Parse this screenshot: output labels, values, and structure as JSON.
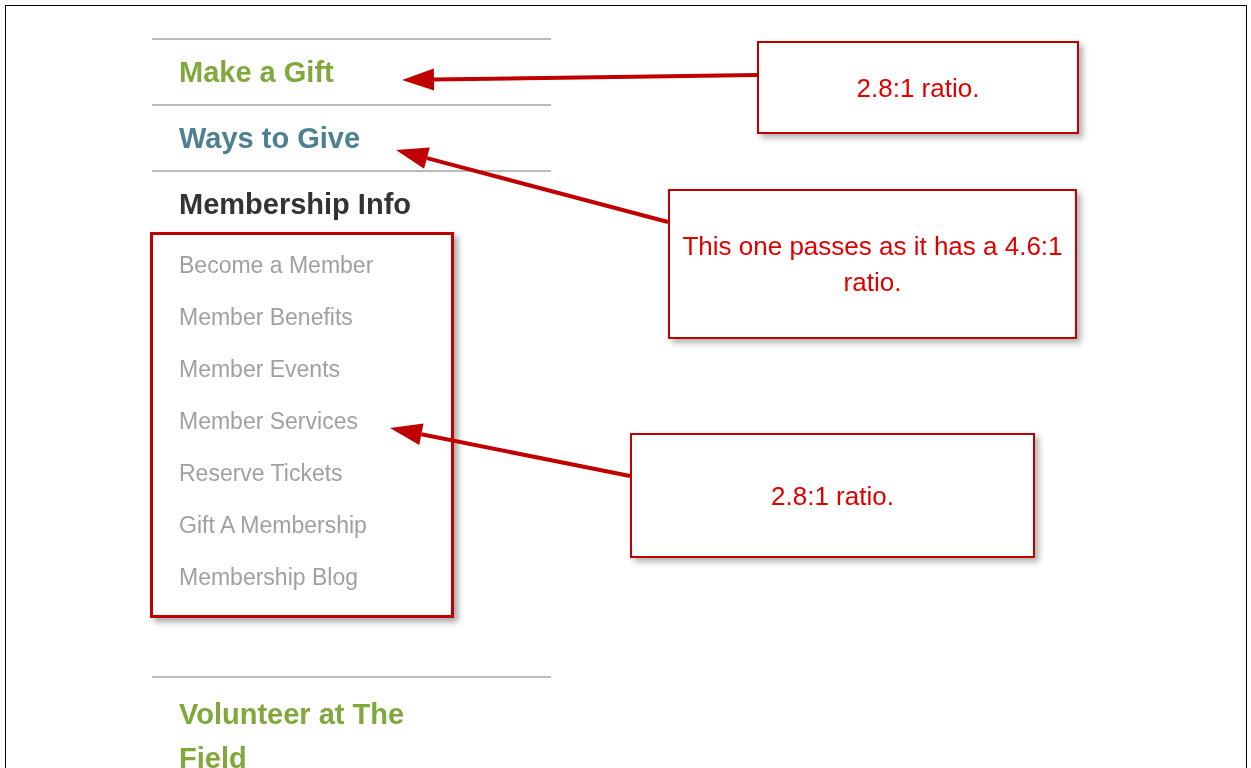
{
  "nav": [
    {
      "label": "Make a Gift",
      "color": "#80a83a"
    },
    {
      "label": "Ways to Give",
      "color": "#4d8091"
    },
    {
      "label": "Membership Info",
      "color": "#333333",
      "children": [
        "Become a Member",
        "Member Benefits",
        "Member Events",
        "Member Services",
        "Reserve Tickets",
        "Gift A Membership",
        "Membership Blog"
      ]
    },
    {
      "label": "Volunteer at The Field",
      "color": "#80a83a"
    }
  ],
  "callouts": [
    {
      "text": "2.8:1 ratio."
    },
    {
      "text": "This one passes as it has a 4.6:1 ratio."
    },
    {
      "text": "2.8:1 ratio."
    }
  ]
}
